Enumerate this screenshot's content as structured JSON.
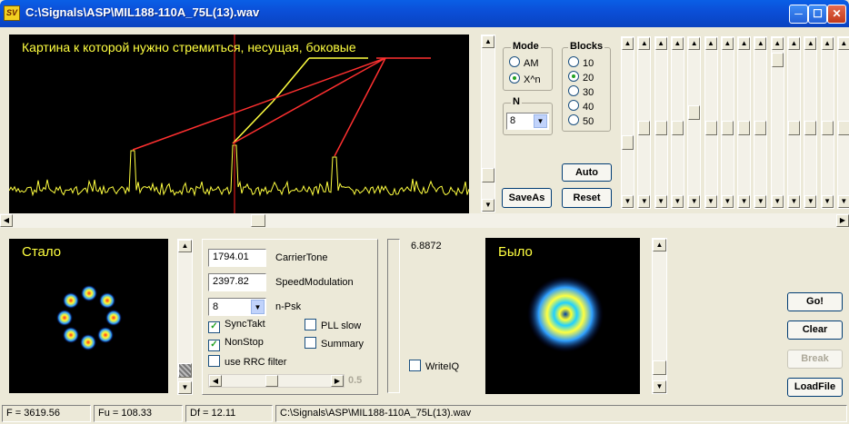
{
  "window": {
    "title": "C:\\Signals\\ASP\\MIL188-110A_75L(13).wav",
    "icon_text": "SV",
    "minimize_icon": "minimize-icon",
    "maximize_icon": "maximize-icon",
    "close_icon": "close-icon"
  },
  "spectrum": {
    "annotation": "Картина к которой нужно стремиться, несущая, боковые",
    "line_colors": {
      "signal": "#ffff40",
      "marker": "#ff2020",
      "annotation_yellow": "#ffff40",
      "annotation_red": "#ff3030"
    }
  },
  "mode": {
    "title": "Mode",
    "options": [
      "AM",
      "X^n"
    ],
    "selected": 1
  },
  "blocks": {
    "title": "Blocks",
    "options": [
      "10",
      "20",
      "30",
      "40",
      "50"
    ],
    "selected": 1
  },
  "n_group": {
    "title": "N",
    "value": "8"
  },
  "buttons": {
    "auto": "Auto",
    "saveas": "SaveAs",
    "reset": "Reset",
    "go": "Go!",
    "clear": "Clear",
    "break": "Break",
    "loadfile": "LoadFile"
  },
  "after_panel": {
    "label": "Стало"
  },
  "before_panel": {
    "label": "Было"
  },
  "params": {
    "carrier_value": "1794.01",
    "carrier_label": "CarrierTone",
    "speed_value": "2397.82",
    "speed_label": "SpeedModulation",
    "npsk_value": "8",
    "npsk_label": "n-Psk",
    "synctakt_label": "SyncTakt",
    "synctakt_checked": true,
    "nonstop_label": "NonStop",
    "nonstop_checked": true,
    "rrc_label": "use RRC filter",
    "rrc_checked": false,
    "pll_label": "PLL slow",
    "pll_checked": false,
    "summary_label": "Summary",
    "summary_checked": false,
    "slider_value": "0.5",
    "slider_level": 0.45
  },
  "level_value": "6.8872",
  "writeiq_label": "WriteIQ",
  "status": {
    "f": "F = 3619.56",
    "fu": "Fu = 108.33",
    "df": "Df = 12.11",
    "path": "C:\\Signals\\ASP\\MIL188-110A_75L(13).wav"
  }
}
